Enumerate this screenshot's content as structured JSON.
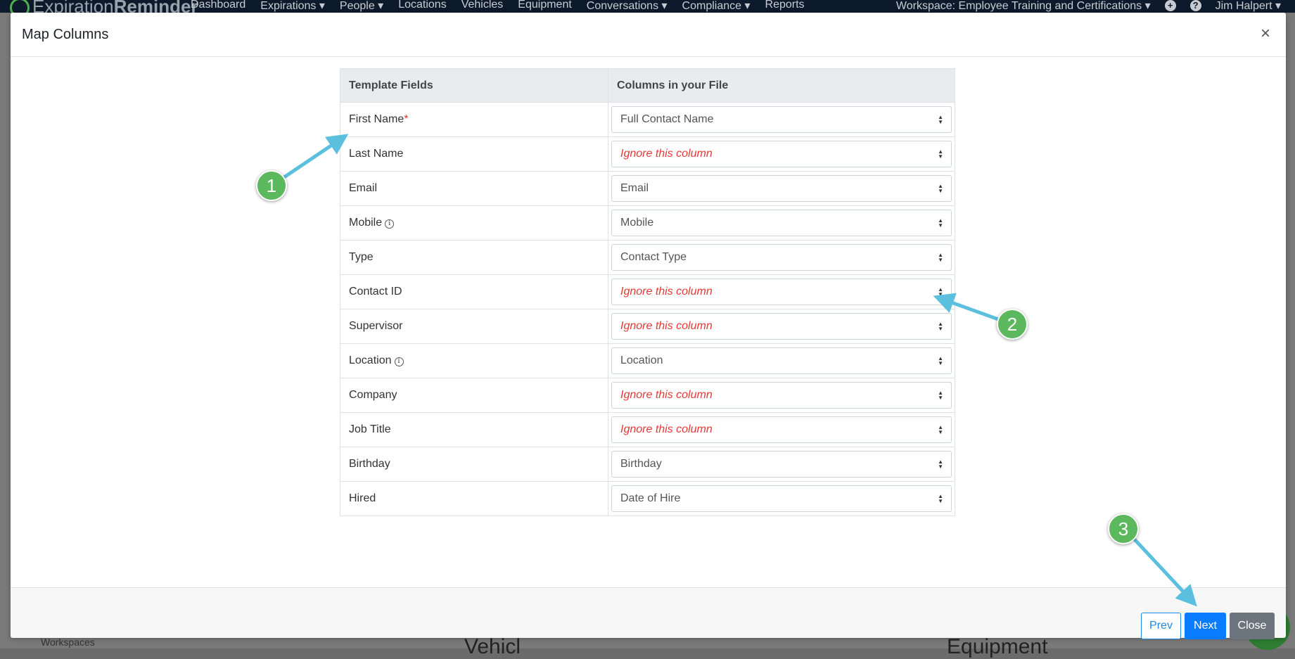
{
  "navbar": {
    "brand_light": "Expiration",
    "brand_bold": "Reminder",
    "links": [
      "Dashboard",
      "Expirations ▾",
      "People ▾",
      "Locations",
      "Vehicles",
      "Equipment",
      "Conversations ▾",
      "Compliance ▾",
      "Reports"
    ],
    "workspace": "Workspace: Employee Training and Certifications ▾",
    "user": "Jim Halpert ▾"
  },
  "background": {
    "sidebar_label": "Workspaces",
    "heading_left": "Vehicl",
    "heading_right": "Equipment"
  },
  "modal": {
    "title": "Map Columns",
    "close_glyph": "×",
    "table": {
      "headers": [
        "Template Fields",
        "Columns in your File"
      ],
      "rows": [
        {
          "field": "First Name",
          "required": "*",
          "value": "Full Contact Name"
        },
        {
          "field": "Last Name",
          "value": "Ignore this column"
        },
        {
          "field": "Email",
          "value": "Email"
        },
        {
          "field": "Mobile",
          "info": "i",
          "value": "Mobile"
        },
        {
          "field": "Type",
          "value": "Contact Type"
        },
        {
          "field": "Contact ID",
          "value": "Ignore this column"
        },
        {
          "field": "Supervisor",
          "value": "Ignore this column"
        },
        {
          "field": "Location",
          "info": "i",
          "value": "Location"
        },
        {
          "field": "Company",
          "value": "Ignore this column"
        },
        {
          "field": "Job Title",
          "value": "Ignore this column"
        },
        {
          "field": "Birthday",
          "value": "Birthday"
        },
        {
          "field": "Hired",
          "value": "Date of Hire"
        }
      ]
    },
    "footer": {
      "prev_label": "Prev",
      "next_label": "Next",
      "close_label": "Close"
    }
  },
  "annotations": {
    "markers": [
      "1",
      "2",
      "3"
    ],
    "color": "#5cb85c",
    "arrow_color": "#5bc0de"
  }
}
